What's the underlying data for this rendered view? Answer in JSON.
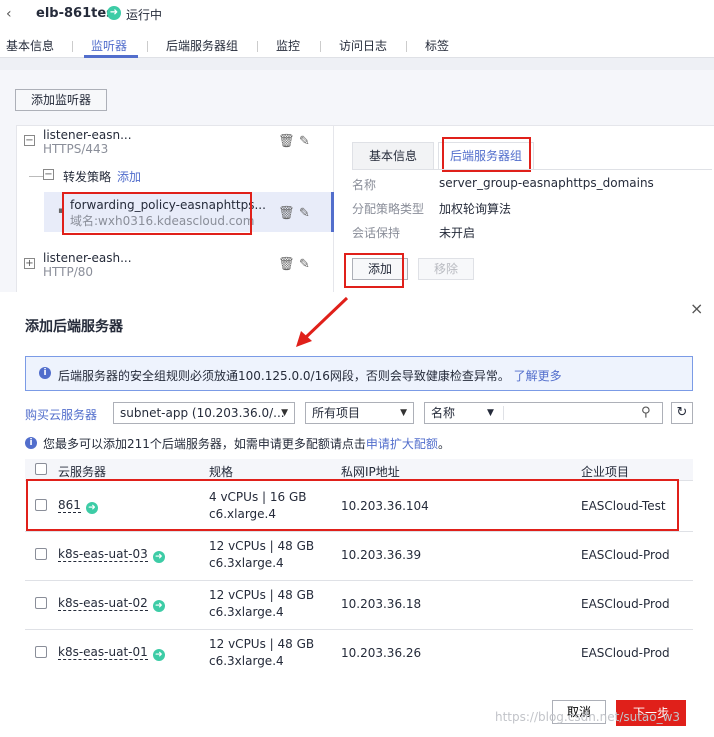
{
  "header": {
    "back_glyph": "‹",
    "title": "elb-861test",
    "status": "运行中"
  },
  "tabs": [
    "基本信息",
    "监听器",
    "后端服务器组",
    "监控",
    "访问日志",
    "标签"
  ],
  "toolbar": {
    "add_listener": "添加监听器"
  },
  "listeners": [
    {
      "name": "listener-easn...",
      "protocol": "HTTPS/443"
    },
    {
      "name": "listener-eash...",
      "protocol": "HTTP/80"
    }
  ],
  "policy": {
    "label": "转发策略",
    "add_link": "添加",
    "name": "forwarding_policy-easnaphttps...",
    "domain": "域名:wxh0316.kdeascloud.com"
  },
  "detail": {
    "tabs": [
      "基本信息",
      "后端服务器组"
    ],
    "rows": [
      {
        "key": "名称",
        "value": "server_group-easnaphttps_domains"
      },
      {
        "key": "分配策略类型",
        "value": "加权轮询算法"
      },
      {
        "key": "会话保持",
        "value": "未开启"
      }
    ],
    "add_button": "添加",
    "remove_button": "移除"
  },
  "dialog": {
    "title": "添加后端服务器",
    "close": "×",
    "notice": "后端服务器的安全组规则必须放通100.125.0.0/16网段，否则会导致健康检查异常。",
    "notice_link": "了解更多",
    "buy_link": "购买云服务器",
    "subnet_select": "subnet-app (10.203.36.0/...",
    "project_select": "所有项目",
    "field_select": "名称",
    "hint_prefix": "您最多可以添加211个后端服务器，如需申请更多配额请点击",
    "hint_link": "申请扩大配额",
    "hint_suffix": "。",
    "columns": [
      "云服务器",
      "规格",
      "私网IP地址",
      "企业项目"
    ],
    "rows": [
      {
        "name": "861",
        "spec1": "4 vCPUs | 16 GB",
        "spec2": "c6.xlarge.4",
        "ip": "10.203.36.104",
        "project": "EASCloud-Test"
      },
      {
        "name": "k8s-eas-uat-03",
        "spec1": "12 vCPUs | 48 GB",
        "spec2": "c6.3xlarge.4",
        "ip": "10.203.36.39",
        "project": "EASCloud-Prod"
      },
      {
        "name": "k8s-eas-uat-02",
        "spec1": "12 vCPUs | 48 GB",
        "spec2": "c6.3xlarge.4",
        "ip": "10.203.36.18",
        "project": "EASCloud-Prod"
      },
      {
        "name": "k8s-eas-uat-01",
        "spec1": "12 vCPUs | 48 GB",
        "spec2": "c6.3xlarge.4",
        "ip": "10.203.36.26",
        "project": "EASCloud-Prod"
      }
    ],
    "cancel": "取消",
    "next": "下一步"
  },
  "watermark": "https://blog.csdn.net/sutao_w3",
  "colors": {
    "accent": "#526ecc",
    "highlight": "#e0201a",
    "running": "#3dcca6"
  }
}
